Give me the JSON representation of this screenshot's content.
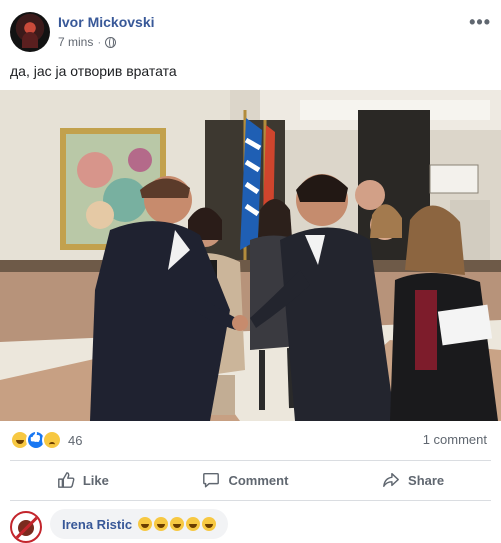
{
  "post": {
    "author": "Ivor Mickovski",
    "timestamp": "7 mins",
    "separator": "·",
    "privacy_icon": "globe-icon",
    "more_icon": "ellipsis-icon",
    "more_label": "•••",
    "caption": "да, јас ја отворив вратата"
  },
  "photo": {
    "description_icon": "photo"
  },
  "reactions": {
    "types": [
      "haha",
      "like",
      "sad"
    ],
    "count": "46",
    "comments": "1 comment"
  },
  "actions": {
    "like": "Like",
    "comment": "Comment",
    "share": "Share"
  },
  "comment": {
    "author": "Irena Ristic",
    "emoji_count": 5,
    "emoji": "laughing-face"
  },
  "colors": {
    "link": "#385898",
    "muted": "#606770",
    "divider": "#dadde1",
    "like_blue": "#1877f2"
  }
}
